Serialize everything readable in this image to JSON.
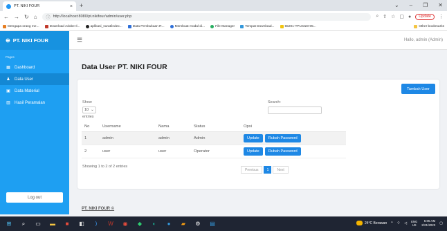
{
  "browser": {
    "tab_title": "PT. NIKI FOUR",
    "url": "http://localhost:8080/pt.nikifour/admin/user.php",
    "update_label": "Update",
    "bookmarks": [
      "Mengapa orang me...",
      "Download Adobe Il...",
      "aplikasi_surat/index...",
      "Data Pembukaan R...",
      "Membuat modal di...",
      "File Manager",
      "Tempat Download...",
      "55201-TPL0323-05...",
      "Other bookmarks"
    ]
  },
  "sidebar": {
    "brand": "PT. NIKI FOUR",
    "section_label": "Pages",
    "items": [
      {
        "label": "Dashboard",
        "icon": "dashboard-icon"
      },
      {
        "label": "Data User",
        "icon": "user-icon"
      },
      {
        "label": "Data Material",
        "icon": "box-icon"
      },
      {
        "label": "Hasil Peramalan",
        "icon": "chart-icon"
      }
    ],
    "logout_label": "Log out"
  },
  "topbar": {
    "greeting": "Hallo, admin (Admin)"
  },
  "page": {
    "title": "Data User PT. NIKI FOUR",
    "add_button": "Tambah User",
    "show_label": "Show",
    "page_size": "10",
    "entries_label": "entries",
    "search_label": "Search:",
    "search_value": "",
    "columns": [
      "No",
      "Username",
      "Nama",
      "Status",
      "Opsi"
    ],
    "rows": [
      {
        "no": "1",
        "username": "admin",
        "nama": "admin",
        "status": "Admin",
        "update": "Update",
        "reset": "Rubah Password"
      },
      {
        "no": "2",
        "username": "user",
        "nama": "user",
        "status": "Operator",
        "update": "Update",
        "reset": "Rubah Password"
      }
    ],
    "info": "Showing 1 to 2 of 2 entries",
    "pagination": {
      "prev": "Previous",
      "current": "1",
      "next": "Next"
    }
  },
  "footer": {
    "text": "PT. NIKI FOUR ©"
  },
  "taskbar": {
    "weather": "24°C Berawan",
    "lang_top": "ENG",
    "lang_bottom": "US",
    "time": "5:05 AM",
    "date": "2/21/2023"
  },
  "colors": {
    "sidebar": "#1e9ff2",
    "primary_button": "#1e88e5",
    "taskbar": "#1f2533"
  }
}
